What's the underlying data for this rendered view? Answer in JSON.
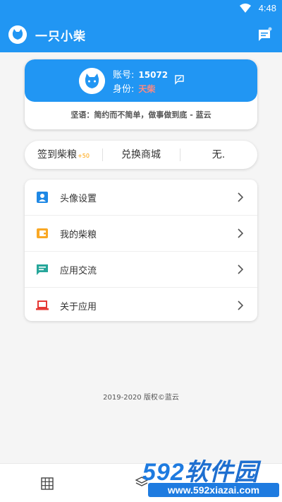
{
  "status_bar": {
    "time": "4:48"
  },
  "app_bar": {
    "title": "一只小柴",
    "logo_icon": "shiba-icon",
    "message_icon": "message-icon"
  },
  "profile": {
    "account_label": "账号:",
    "account_value": "15072",
    "identity_label": "身份:",
    "identity_value": "天柴",
    "motto": "坚语：简约而不简单，做事做到底 - 蓝云"
  },
  "tabs": [
    {
      "label": "签到柴粮",
      "badge": "+50"
    },
    {
      "label": "兑换商城"
    },
    {
      "label": "无."
    }
  ],
  "menu": [
    {
      "label": "头像设置",
      "icon": "avatar-setting-icon",
      "color": "#1e88e5"
    },
    {
      "label": "我的柴粮",
      "icon": "wallet-icon",
      "color": "#f9a825"
    },
    {
      "label": "应用交流",
      "icon": "chat-icon",
      "color": "#26a69a"
    },
    {
      "label": "关于应用",
      "icon": "laptop-icon",
      "color": "#e53935"
    }
  ],
  "footer": {
    "copyright": "2019-2020 版权©蓝云"
  },
  "bottom_nav": [
    {
      "icon": "grid-icon"
    },
    {
      "icon": "layers-icon"
    }
  ],
  "watermark": {
    "brand_num": "592",
    "brand_text": "软件园",
    "url": "www.592xiazai.com"
  },
  "colors": {
    "primary": "#2196f3",
    "identity": "#ff8a80",
    "badge": "#ffa000"
  }
}
